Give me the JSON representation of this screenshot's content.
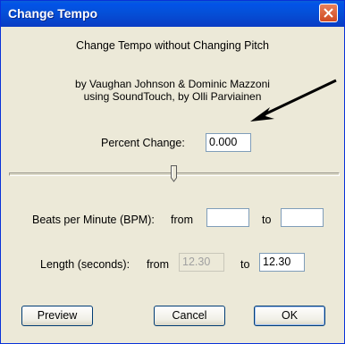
{
  "window": {
    "title": "Change Tempo",
    "close_icon": "close-x-icon",
    "accent": "#0450d8",
    "close_color": "#d9552e"
  },
  "description": {
    "heading": "Change Tempo without Changing Pitch",
    "credit_line1": "by Vaughan Johnson & Dominic Mazzoni",
    "credit_line2": "using SoundTouch, by Olli Parviainen"
  },
  "percent_change": {
    "label": "Percent Change:",
    "value": "0.000"
  },
  "slider": {
    "level": 0.5
  },
  "bpm": {
    "label": "Beats per Minute (BPM):",
    "from_label": "from",
    "to_label": "to",
    "from_value": "",
    "to_value": ""
  },
  "length": {
    "label": "Length (seconds):",
    "from_label": "from",
    "to_label": "to",
    "from_value": "12.30",
    "to_value": "12.30"
  },
  "buttons": {
    "preview": "Preview",
    "cancel": "Cancel",
    "ok": "OK"
  },
  "annotation": {
    "arrow_color": "#000000"
  }
}
